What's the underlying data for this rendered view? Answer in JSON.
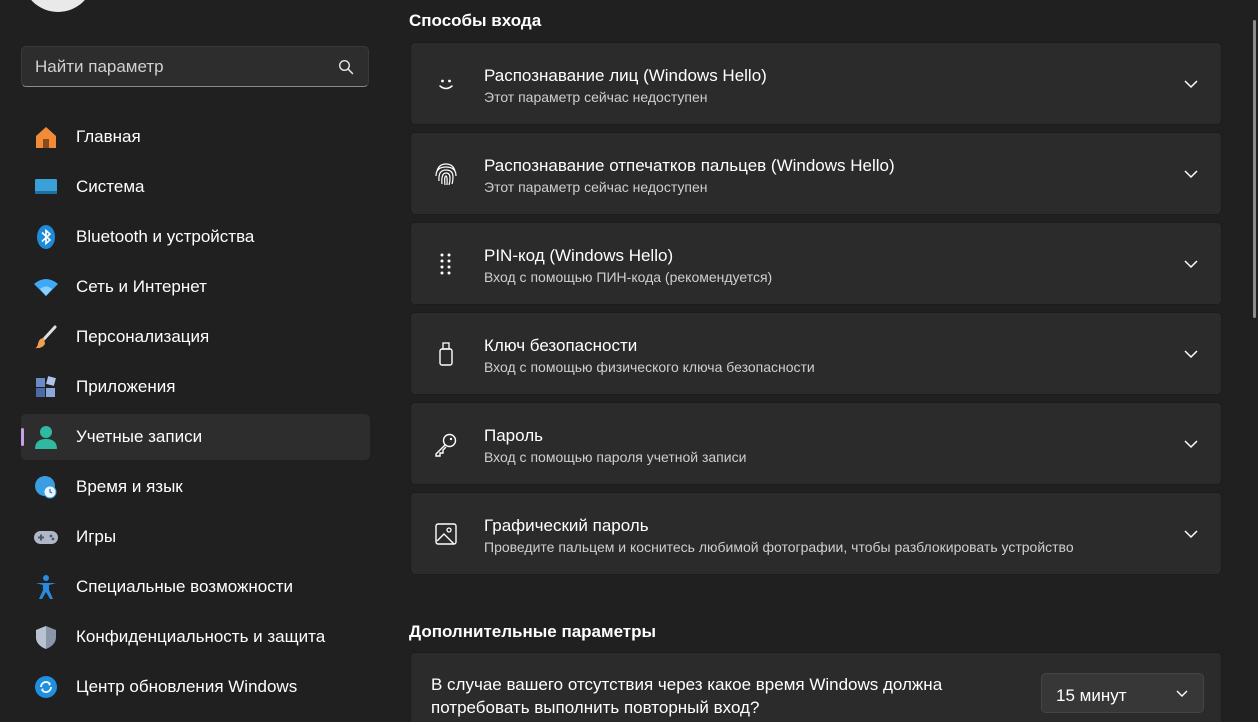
{
  "search": {
    "placeholder": "Найти параметр",
    "icon": "search-icon"
  },
  "sidebar": {
    "items": [
      {
        "label": "Главная",
        "icon": "home-icon",
        "color": "#f28b38"
      },
      {
        "label": "Система",
        "icon": "system-display-icon",
        "color": "#3aa0d8"
      },
      {
        "label": "Bluetooth и устройства",
        "icon": "bluetooth-icon",
        "color": "#1f8bd8"
      },
      {
        "label": "Сеть и Интернет",
        "icon": "wifi-icon",
        "color": "#3fa9f5"
      },
      {
        "label": "Персонализация",
        "icon": "brush-icon",
        "color": "#f0a050"
      },
      {
        "label": "Приложения",
        "icon": "apps-icon",
        "color": "#6a8ac8"
      },
      {
        "label": "Учетные записи",
        "icon": "account-icon",
        "color": "#2fb9a0",
        "active": true
      },
      {
        "label": "Время и язык",
        "icon": "globe-clock-icon",
        "color": "#3a9ee0"
      },
      {
        "label": "Игры",
        "icon": "gamepad-icon",
        "color": "#b0b8c8"
      },
      {
        "label": "Специальные возможности",
        "icon": "accessibility-icon",
        "color": "#2a8ae0"
      },
      {
        "label": "Конфиденциальность и защита",
        "icon": "shield-icon",
        "color": "#8a96a8"
      },
      {
        "label": "Центр обновления Windows",
        "icon": "update-icon",
        "color": "#1f8fe0"
      }
    ]
  },
  "main": {
    "signin_title": "Способы входа",
    "options": [
      {
        "title": "Распознавание лиц (Windows Hello)",
        "subtitle": "Этот параметр сейчас недоступен",
        "icon": "face-icon"
      },
      {
        "title": "Распознавание отпечатков пальцев (Windows Hello)",
        "subtitle": "Этот параметр сейчас недоступен",
        "icon": "fingerprint-icon"
      },
      {
        "title": "PIN-код (Windows Hello)",
        "subtitle": "Вход с помощью ПИН-кода (рекомендуется)",
        "icon": "pin-keypad-icon"
      },
      {
        "title": "Ключ безопасности",
        "subtitle": "Вход с помощью физического ключа безопасности",
        "icon": "usb-key-icon"
      },
      {
        "title": "Пароль",
        "subtitle": "Вход с помощью пароля учетной записи",
        "icon": "key-icon"
      },
      {
        "title": "Графический пароль",
        "subtitle": "Проведите пальцем и коснитесь любимой фотографии, чтобы разблокировать устройство",
        "icon": "picture-icon"
      }
    ],
    "additional_title": "Дополнительные параметры",
    "relogin": {
      "text": "В случае вашего отсутствия через какое время Windows должна потребовать выполнить повторный вход?",
      "value": "15 минут"
    }
  },
  "colors": {
    "accent": "#c8a0e8",
    "background": "#202020",
    "card": "#2b2b2b"
  }
}
